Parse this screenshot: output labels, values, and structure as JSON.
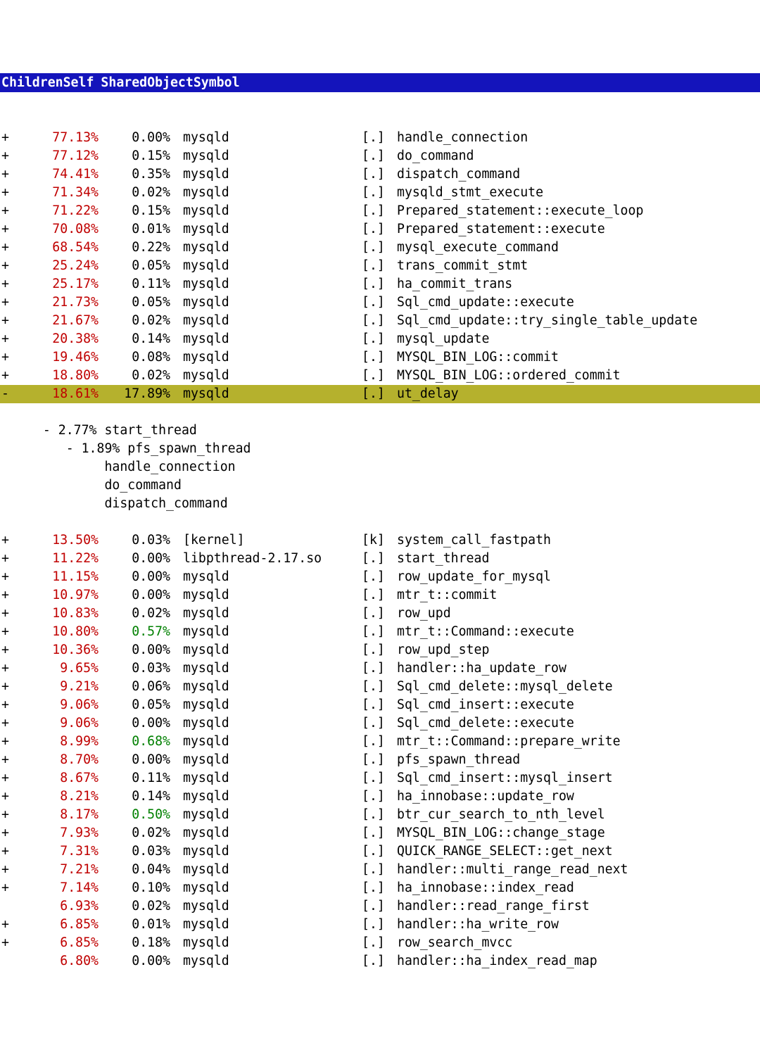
{
  "header": {
    "children": "Children",
    "self": "Self",
    "shared": "Shared",
    "object": "Object",
    "symbol": "Symbol"
  },
  "rows": [
    {
      "expand": "+",
      "children": "77.13%",
      "self": "0.00%",
      "object": "mysqld",
      "marker": "[.]",
      "symbol": "handle_connection",
      "children_color": "red",
      "self_color": "",
      "hl": false
    },
    {
      "expand": "+",
      "children": "77.12%",
      "self": "0.15%",
      "object": "mysqld",
      "marker": "[.]",
      "symbol": "do_command",
      "children_color": "red",
      "self_color": "",
      "hl": false
    },
    {
      "expand": "+",
      "children": "74.41%",
      "self": "0.35%",
      "object": "mysqld",
      "marker": "[.]",
      "symbol": "dispatch_command",
      "children_color": "red",
      "self_color": "",
      "hl": false
    },
    {
      "expand": "+",
      "children": "71.34%",
      "self": "0.02%",
      "object": "mysqld",
      "marker": "[.]",
      "symbol": "mysqld_stmt_execute",
      "children_color": "red",
      "self_color": "",
      "hl": false
    },
    {
      "expand": "+",
      "children": "71.22%",
      "self": "0.15%",
      "object": "mysqld",
      "marker": "[.]",
      "symbol": "Prepared_statement::execute_loop",
      "children_color": "red",
      "self_color": "",
      "hl": false
    },
    {
      "expand": "+",
      "children": "70.08%",
      "self": "0.01%",
      "object": "mysqld",
      "marker": "[.]",
      "symbol": "Prepared_statement::execute",
      "children_color": "red",
      "self_color": "",
      "hl": false
    },
    {
      "expand": "+",
      "children": "68.54%",
      "self": "0.22%",
      "object": "mysqld",
      "marker": "[.]",
      "symbol": "mysql_execute_command",
      "children_color": "red",
      "self_color": "",
      "hl": false
    },
    {
      "expand": "+",
      "children": "25.24%",
      "self": "0.05%",
      "object": "mysqld",
      "marker": "[.]",
      "symbol": "trans_commit_stmt",
      "children_color": "red",
      "self_color": "",
      "hl": false
    },
    {
      "expand": "+",
      "children": "25.17%",
      "self": "0.11%",
      "object": "mysqld",
      "marker": "[.]",
      "symbol": "ha_commit_trans",
      "children_color": "red",
      "self_color": "",
      "hl": false
    },
    {
      "expand": "+",
      "children": "21.73%",
      "self": "0.05%",
      "object": "mysqld",
      "marker": "[.]",
      "symbol": "Sql_cmd_update::execute",
      "children_color": "red",
      "self_color": "",
      "hl": false
    },
    {
      "expand": "+",
      "children": "21.67%",
      "self": "0.02%",
      "object": "mysqld",
      "marker": "[.]",
      "symbol": "Sql_cmd_update::try_single_table_update",
      "children_color": "red",
      "self_color": "",
      "hl": false
    },
    {
      "expand": "+",
      "children": "20.38%",
      "self": "0.14%",
      "object": "mysqld",
      "marker": "[.]",
      "symbol": "mysql_update",
      "children_color": "red",
      "self_color": "",
      "hl": false
    },
    {
      "expand": "+",
      "children": "19.46%",
      "self": "0.08%",
      "object": "mysqld",
      "marker": "[.]",
      "symbol": "MYSQL_BIN_LOG::commit",
      "children_color": "red",
      "self_color": "",
      "hl": false
    },
    {
      "expand": "+",
      "children": "18.80%",
      "self": "0.02%",
      "object": "mysqld",
      "marker": "[.]",
      "symbol": "MYSQL_BIN_LOG::ordered_commit",
      "children_color": "red",
      "self_color": "",
      "hl": false
    },
    {
      "expand": "-",
      "children": "18.61%",
      "self": "17.89%",
      "object": "mysqld",
      "marker": "[.]",
      "symbol": "ut_delay",
      "children_color": "red",
      "self_color": "",
      "hl": true
    }
  ],
  "tree": [
    "   - 2.77% start_thread",
    "      - 1.89% pfs_spawn_thread",
    "           handle_connection",
    "           do_command",
    "           dispatch_command"
  ],
  "rows2": [
    {
      "expand": "+",
      "children": "13.50%",
      "self": "0.03%",
      "object": "[kernel]",
      "marker": "[k]",
      "symbol": "system_call_fastpath",
      "children_color": "red",
      "self_color": "",
      "hl": false
    },
    {
      "expand": "+",
      "children": "11.22%",
      "self": "0.00%",
      "object": "libpthread-2.17.so",
      "marker": "[.]",
      "symbol": "start_thread",
      "children_color": "red",
      "self_color": "",
      "hl": false
    },
    {
      "expand": "+",
      "children": "11.15%",
      "self": "0.00%",
      "object": "mysqld",
      "marker": "[.]",
      "symbol": "row_update_for_mysql",
      "children_color": "red",
      "self_color": "",
      "hl": false
    },
    {
      "expand": "+",
      "children": "10.97%",
      "self": "0.00%",
      "object": "mysqld",
      "marker": "[.]",
      "symbol": "mtr_t::commit",
      "children_color": "red",
      "self_color": "",
      "hl": false
    },
    {
      "expand": "+",
      "children": "10.83%",
      "self": "0.02%",
      "object": "mysqld",
      "marker": "[.]",
      "symbol": "row_upd",
      "children_color": "red",
      "self_color": "",
      "hl": false
    },
    {
      "expand": "+",
      "children": "10.80%",
      "self": "0.57%",
      "object": "mysqld",
      "marker": "[.]",
      "symbol": "mtr_t::Command::execute",
      "children_color": "red",
      "self_color": "green",
      "hl": false
    },
    {
      "expand": "+",
      "children": "10.36%",
      "self": "0.00%",
      "object": "mysqld",
      "marker": "[.]",
      "symbol": "row_upd_step",
      "children_color": "red",
      "self_color": "",
      "hl": false
    },
    {
      "expand": "+",
      "children": "9.65%",
      "self": "0.03%",
      "object": "mysqld",
      "marker": "[.]",
      "symbol": "handler::ha_update_row",
      "children_color": "red",
      "self_color": "",
      "hl": false
    },
    {
      "expand": "+",
      "children": "9.21%",
      "self": "0.06%",
      "object": "mysqld",
      "marker": "[.]",
      "symbol": "Sql_cmd_delete::mysql_delete",
      "children_color": "red",
      "self_color": "",
      "hl": false
    },
    {
      "expand": "+",
      "children": "9.06%",
      "self": "0.05%",
      "object": "mysqld",
      "marker": "[.]",
      "symbol": "Sql_cmd_insert::execute",
      "children_color": "red",
      "self_color": "",
      "hl": false
    },
    {
      "expand": "+",
      "children": "9.06%",
      "self": "0.00%",
      "object": "mysqld",
      "marker": "[.]",
      "symbol": "Sql_cmd_delete::execute",
      "children_color": "red",
      "self_color": "",
      "hl": false
    },
    {
      "expand": "+",
      "children": "8.99%",
      "self": "0.68%",
      "object": "mysqld",
      "marker": "[.]",
      "symbol": "mtr_t::Command::prepare_write",
      "children_color": "red",
      "self_color": "green",
      "hl": false
    },
    {
      "expand": "+",
      "children": "8.70%",
      "self": "0.00%",
      "object": "mysqld",
      "marker": "[.]",
      "symbol": "pfs_spawn_thread",
      "children_color": "red",
      "self_color": "",
      "hl": false
    },
    {
      "expand": "+",
      "children": "8.67%",
      "self": "0.11%",
      "object": "mysqld",
      "marker": "[.]",
      "symbol": "Sql_cmd_insert::mysql_insert",
      "children_color": "red",
      "self_color": "",
      "hl": false
    },
    {
      "expand": "+",
      "children": "8.21%",
      "self": "0.14%",
      "object": "mysqld",
      "marker": "[.]",
      "symbol": "ha_innobase::update_row",
      "children_color": "red",
      "self_color": "",
      "hl": false
    },
    {
      "expand": "+",
      "children": "8.17%",
      "self": "0.50%",
      "object": "mysqld",
      "marker": "[.]",
      "symbol": "btr_cur_search_to_nth_level",
      "children_color": "red",
      "self_color": "green",
      "hl": false
    },
    {
      "expand": "+",
      "children": "7.93%",
      "self": "0.02%",
      "object": "mysqld",
      "marker": "[.]",
      "symbol": "MYSQL_BIN_LOG::change_stage",
      "children_color": "red",
      "self_color": "",
      "hl": false
    },
    {
      "expand": "+",
      "children": "7.31%",
      "self": "0.03%",
      "object": "mysqld",
      "marker": "[.]",
      "symbol": "QUICK_RANGE_SELECT::get_next",
      "children_color": "red",
      "self_color": "",
      "hl": false
    },
    {
      "expand": "+",
      "children": "7.21%",
      "self": "0.04%",
      "object": "mysqld",
      "marker": "[.]",
      "symbol": "handler::multi_range_read_next",
      "children_color": "red",
      "self_color": "",
      "hl": false
    },
    {
      "expand": "+",
      "children": "7.14%",
      "self": "0.10%",
      "object": "mysqld",
      "marker": "[.]",
      "symbol": "ha_innobase::index_read",
      "children_color": "red",
      "self_color": "",
      "hl": false
    },
    {
      "expand": "",
      "children": "6.93%",
      "self": "0.02%",
      "object": "mysqld",
      "marker": "[.]",
      "symbol": "handler::read_range_first",
      "children_color": "red",
      "self_color": "",
      "hl": false
    },
    {
      "expand": "+",
      "children": "6.85%",
      "self": "0.01%",
      "object": "mysqld",
      "marker": "[.]",
      "symbol": "handler::ha_write_row",
      "children_color": "red",
      "self_color": "",
      "hl": false
    },
    {
      "expand": "+",
      "children": "6.85%",
      "self": "0.18%",
      "object": "mysqld",
      "marker": "[.]",
      "symbol": "row_search_mvcc",
      "children_color": "red",
      "self_color": "",
      "hl": false
    },
    {
      "expand": "",
      "children": "6.80%",
      "self": "0.00%",
      "object": "mysqld",
      "marker": "[.]",
      "symbol": "handler::ha_index_read_map",
      "children_color": "red",
      "self_color": "",
      "hl": false
    }
  ]
}
